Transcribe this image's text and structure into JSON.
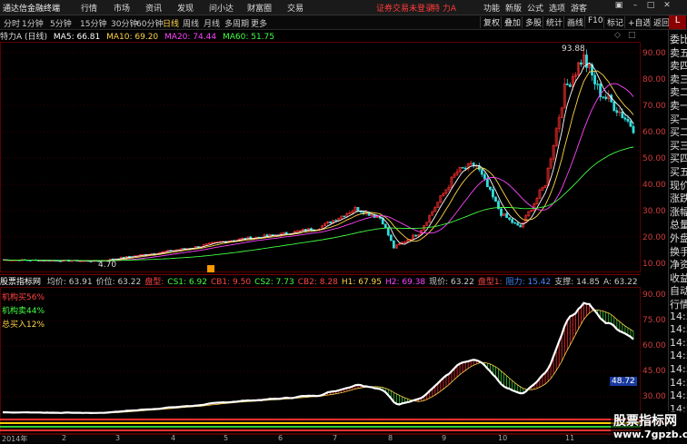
{
  "menu": {
    "app_name": "通达信金融终端",
    "items": [
      "行情",
      "市场",
      "资讯",
      "发现",
      "问小达",
      "财富圈",
      "交易"
    ],
    "alert": "证券交易未登录",
    "stock_short": "特 力A",
    "right_items": [
      "功能",
      "新版",
      "公式",
      "选项",
      "游客"
    ]
  },
  "periods": {
    "tabs": [
      "分时",
      "1分钟",
      "5分钟",
      "15分钟",
      "30分钟",
      "60分钟",
      "日线",
      "周线",
      "月线",
      "多周期",
      "更多"
    ],
    "active": "日线",
    "tools": [
      "复权",
      "叠加",
      "多股",
      "统计",
      "画线",
      "F10",
      "标记",
      "+自选",
      "返回"
    ]
  },
  "info": {
    "stock": "特力A (日线)",
    "ma": [
      {
        "label": "MA5: 66.81",
        "color": "#ffffff"
      },
      {
        "label": "MA10: 69.20",
        "color": "#ffd54a"
      },
      {
        "label": "MA20: 74.44",
        "color": "#ff44ff"
      },
      {
        "label": "MA60: 51.75",
        "color": "#44ff44"
      }
    ]
  },
  "main_chart": {
    "y_labels": [
      "90.00",
      "80.00",
      "70.00",
      "60.00",
      "50.00",
      "40.00",
      "30.00",
      "20.00",
      "10.00"
    ],
    "ylim": [
      5,
      97
    ],
    "high_label": "93.88",
    "low_label": "4.70"
  },
  "indicator": {
    "title": "股票指标网",
    "items": [
      {
        "label": "均价: 63.91",
        "color": "#cccccc"
      },
      {
        "label": "价位: 63.22",
        "color": "#cccccc"
      },
      {
        "label": "盘型:",
        "color": "#ff4444"
      },
      {
        "label": "CS1: 6.92",
        "color": "#44ff44"
      },
      {
        "label": "CB1: 9.50",
        "color": "#ff4444"
      },
      {
        "label": "CS2: 7.73",
        "color": "#44ff44"
      },
      {
        "label": "CB2: 8.28",
        "color": "#ff4444"
      },
      {
        "label": "H1: 67.95",
        "color": "#ffd54a"
      },
      {
        "label": "H2: 69.38",
        "color": "#ff44ff"
      },
      {
        "label": "现价: 63.22",
        "color": "#cccccc"
      },
      {
        "label": "盘型1:",
        "color": "#ff4444"
      },
      {
        "label": "阻力: 15.42",
        "color": "#4488ff"
      },
      {
        "label": "支撑: 14.85",
        "color": "#cccccc"
      },
      {
        "label": "A: 63.22",
        "color": "#cccccc"
      }
    ],
    "legends": [
      {
        "label": "机构买56%",
        "color": "#ff4444"
      },
      {
        "label": "机构卖44%",
        "color": "#44ff44"
      },
      {
        "label": "总买入12%",
        "color": "#ffd54a"
      }
    ],
    "y_labels": [
      "90.00",
      "75.00",
      "60.00",
      "45.00",
      "30.00",
      "15.00"
    ],
    "current_value": "48.72"
  },
  "dates": [
    "2014年",
    "2",
    "3",
    "4",
    "5",
    "6",
    "7",
    "8",
    "9",
    "10",
    "11"
  ],
  "sidebar": [
    {
      "t": "委比",
      "c": "#ddd"
    },
    {
      "t": "卖五",
      "c": "#ddd"
    },
    {
      "t": "卖四",
      "c": "#ddd"
    },
    {
      "t": "卖三",
      "c": "#ddd"
    },
    {
      "t": "卖二",
      "c": "#ddd"
    },
    {
      "t": "卖一",
      "c": "#ddd"
    },
    {
      "t": "买一",
      "c": "#ddd"
    },
    {
      "t": "买二",
      "c": "#ddd"
    },
    {
      "t": "买三",
      "c": "#ddd"
    },
    {
      "t": "买四",
      "c": "#ddd"
    },
    {
      "t": "买五",
      "c": "#ddd"
    },
    {
      "t": "现价",
      "c": "#ddd"
    },
    {
      "t": "涨跌",
      "c": "#ddd"
    },
    {
      "t": "涨幅",
      "c": "#ddd"
    },
    {
      "t": "总量",
      "c": "#ddd"
    },
    {
      "t": "外盘",
      "c": "#ddd"
    },
    {
      "t": "换手",
      "c": "#ddd"
    },
    {
      "t": "净资",
      "c": "#ddd"
    },
    {
      "t": "收益",
      "c": "#ddd"
    },
    {
      "t": "自动",
      "c": "#ddd"
    },
    {
      "t": "行情",
      "c": "#ddd"
    },
    {
      "t": "14:5",
      "c": "#ddd"
    },
    {
      "t": "14:5",
      "c": "#ddd"
    },
    {
      "t": "14:5",
      "c": "#ddd"
    },
    {
      "t": "14:5",
      "c": "#ddd"
    },
    {
      "t": "14:5",
      "c": "#ddd"
    },
    {
      "t": "14:5",
      "c": "#ddd"
    },
    {
      "t": "14:5",
      "c": "#ddd"
    },
    {
      "t": "14:5",
      "c": "#ddd"
    }
  ],
  "watermark": {
    "line1": "股票指标网",
    "line2": "www.7gpzb.com"
  },
  "top_right_badge": "L"
}
